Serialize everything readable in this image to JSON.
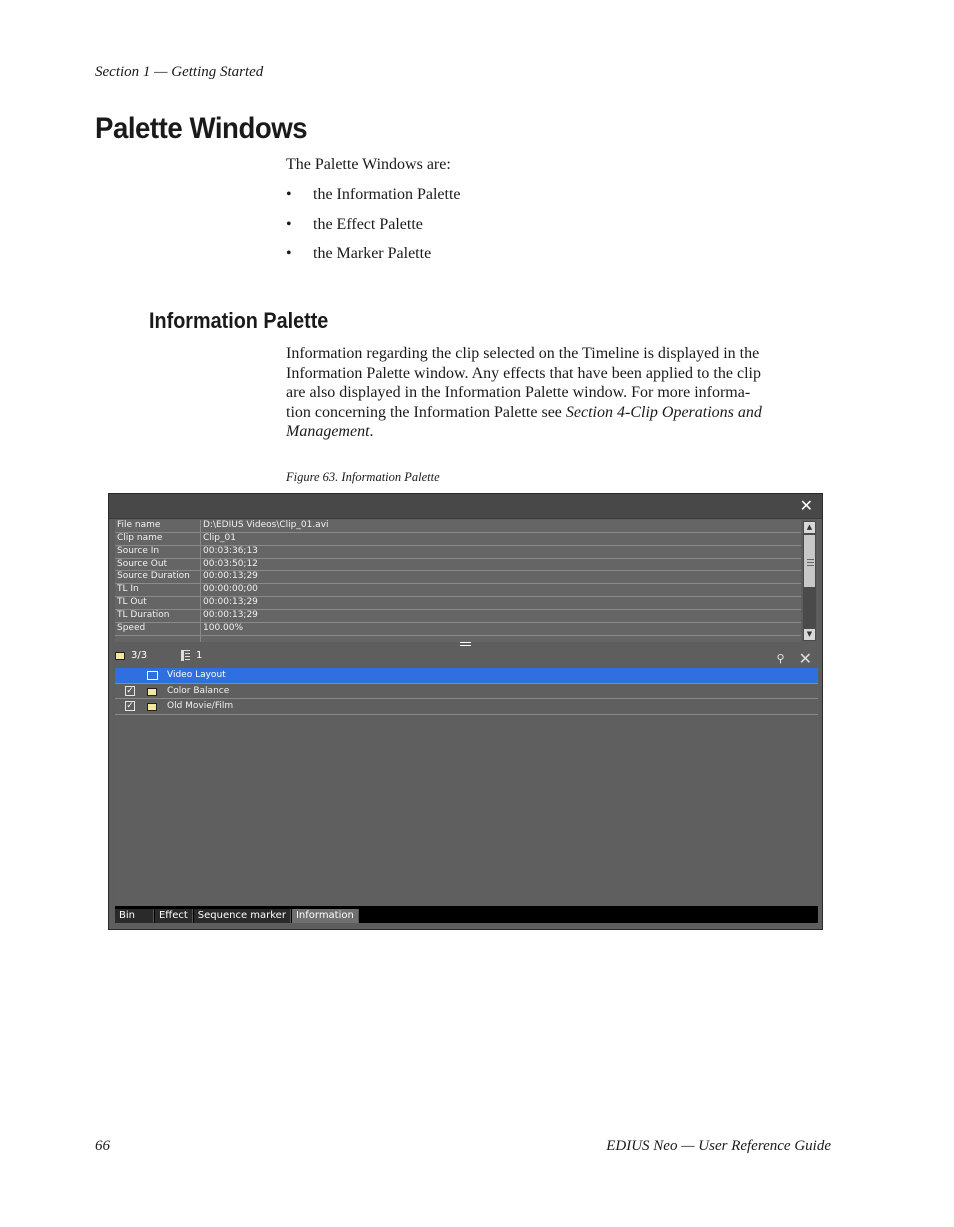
{
  "running_head": "Section 1 — Getting Started",
  "heading": "Palette Windows",
  "intro": "The Palette Windows are:",
  "bullets": [
    "the Information Palette",
    "the Effect Palette",
    "the Marker Palette"
  ],
  "subheading": "Information Palette",
  "paragraph": {
    "lines": [
      "Information regarding the clip selected on the Timeline is displayed in the",
      "Information Palette window. Any effects that have been applied to the clip",
      "are also displayed in the Information Palette window. For more informa-"
    ],
    "last_line_prefix": "tion concerning the Information Palette see ",
    "italic_ref_1": "Section 4-Clip Operations and",
    "italic_ref_2": "Management",
    "end": "."
  },
  "caption": "Figure 63.  Information Palette",
  "palette": {
    "info_rows": [
      {
        "key": "File name",
        "value": "D:\\EDIUS Videos\\Clip_01.avi"
      },
      {
        "key": "Clip name",
        "value": "Clip_01"
      },
      {
        "key": "Source In",
        "value": "00:03:36;13"
      },
      {
        "key": "Source Out",
        "value": "00:03:50;12"
      },
      {
        "key": "Source Duration",
        "value": "00:00:13;29"
      },
      {
        "key": "TL In",
        "value": "00:00:00;00"
      },
      {
        "key": "TL Out",
        "value": "00:00:13;29"
      },
      {
        "key": "TL Duration",
        "value": "00:00:13;29"
      },
      {
        "key": "Speed",
        "value": "100.00%"
      }
    ],
    "toolbar": {
      "count": "3/3",
      "layer": "1"
    },
    "effects": [
      {
        "label": "Video Layout",
        "checked": false,
        "selected": true
      },
      {
        "label": "Color Balance",
        "checked": true,
        "selected": false
      },
      {
        "label": "Old Movie/Film",
        "checked": true,
        "selected": false
      }
    ],
    "tabs": [
      "Bin",
      "Effect",
      "Sequence marker",
      "Information"
    ],
    "active_tab": "Information"
  },
  "footer": {
    "page_number": "66",
    "guide_title": "EDIUS Neo  —  User Reference Guide"
  }
}
